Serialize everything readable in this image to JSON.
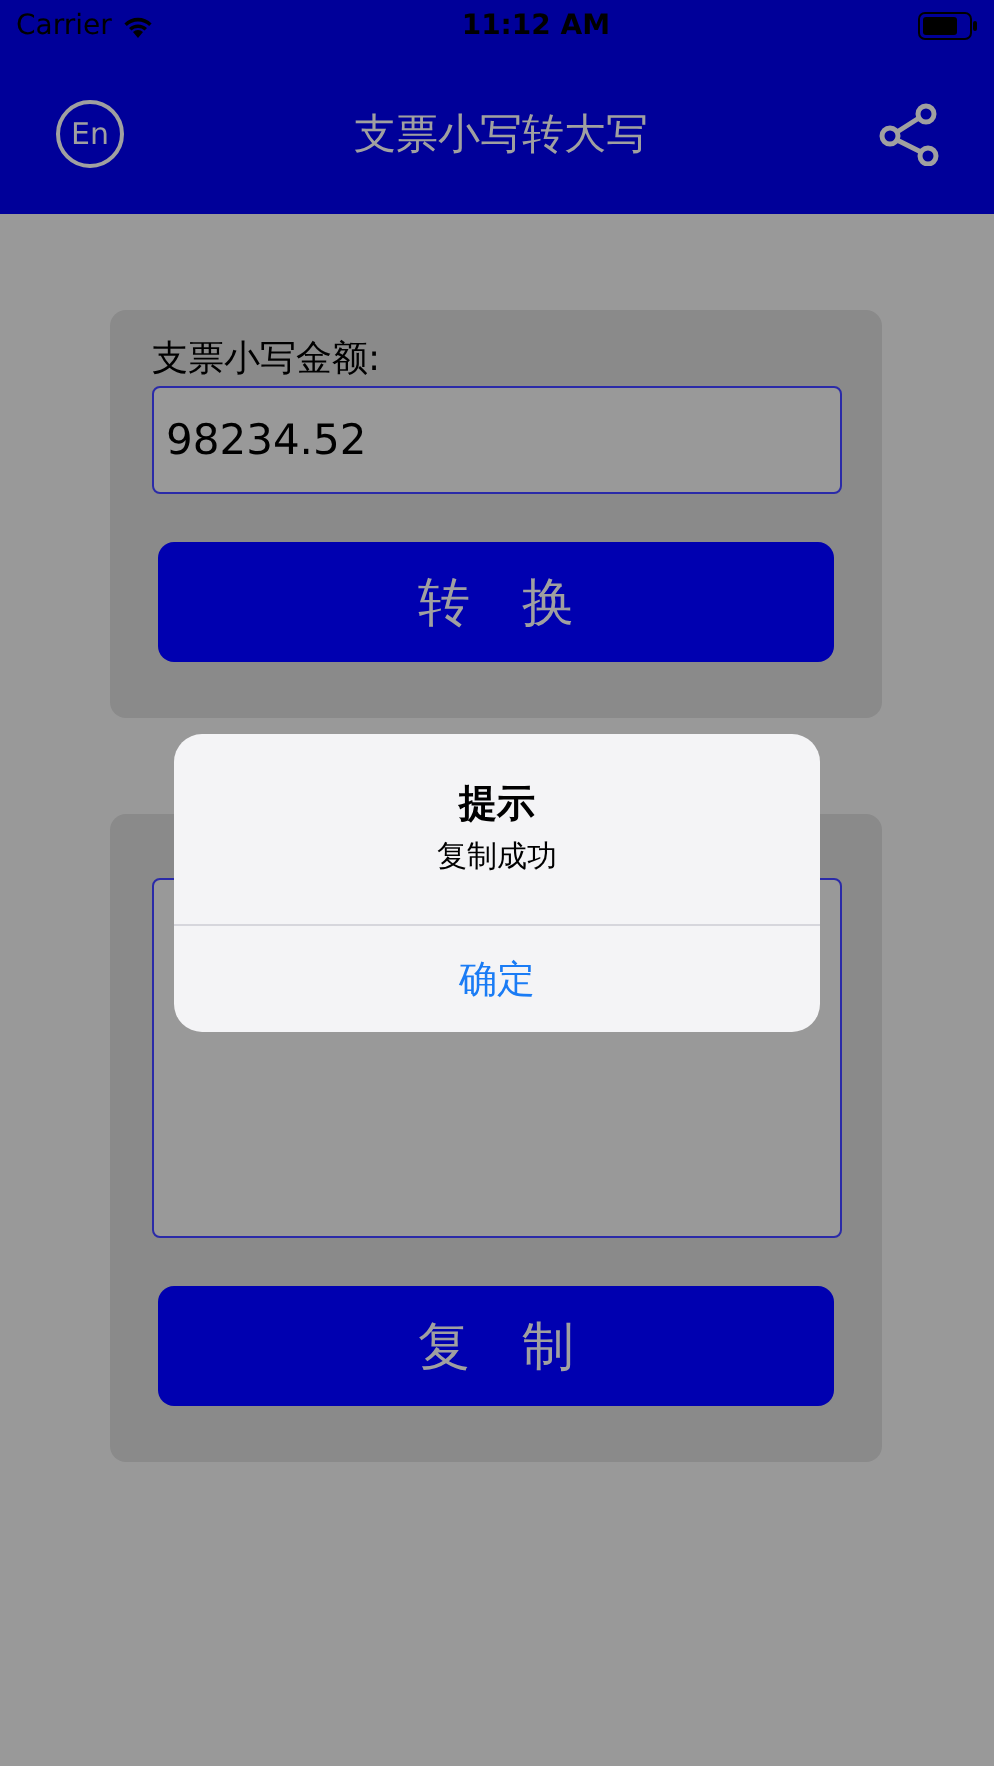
{
  "status_bar": {
    "carrier": "Carrier",
    "time": "11:12 AM"
  },
  "nav": {
    "title": "支票小写转大写",
    "language_button": "En"
  },
  "input_card": {
    "label": "支票小写金额:",
    "value": "98234.52",
    "button": "转　换"
  },
  "result_card": {
    "button": "复　制"
  },
  "alert": {
    "title": "提示",
    "message": "复制成功",
    "button": "确定"
  }
}
